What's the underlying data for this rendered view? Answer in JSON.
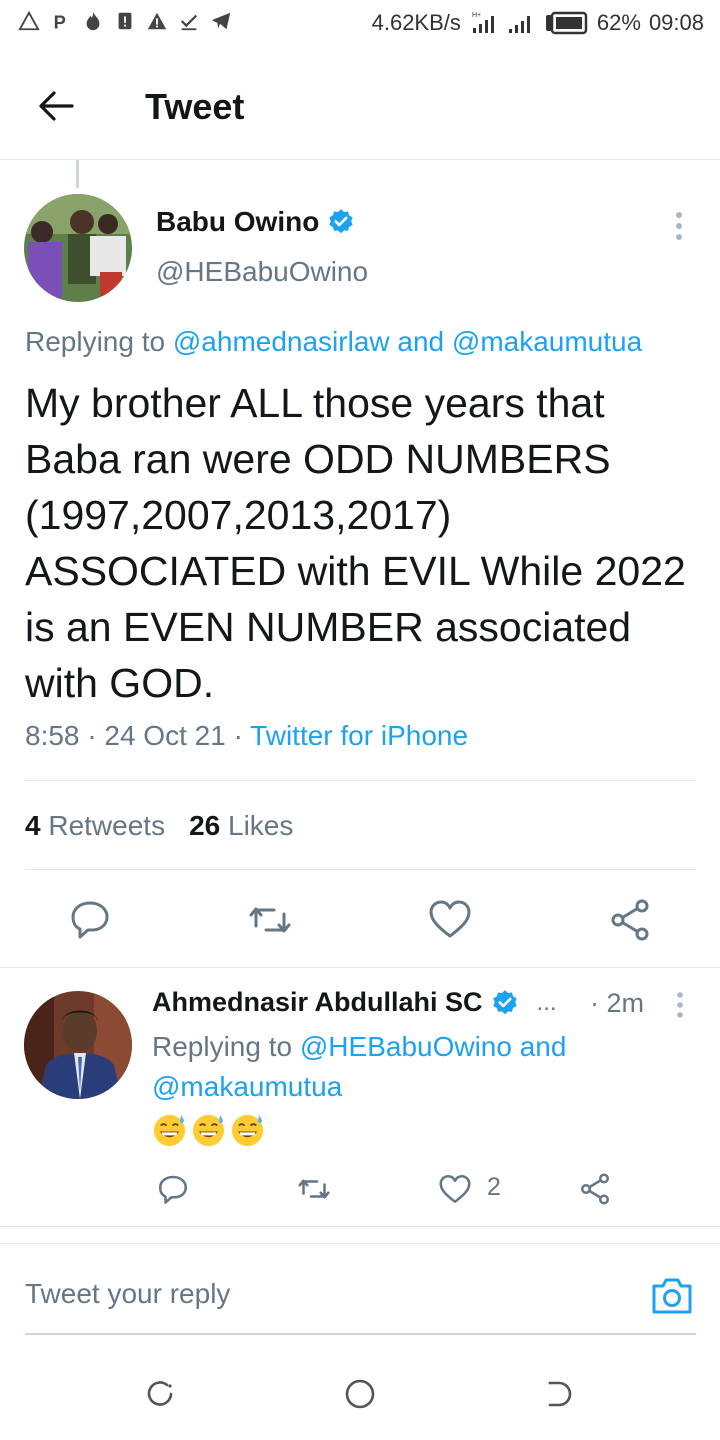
{
  "status_bar": {
    "speed": "4.62KB/s",
    "battery": "62%",
    "time": "09:08"
  },
  "header": {
    "title": "Tweet"
  },
  "tweet": {
    "name": "Babu Owino",
    "handle": "@HEBabuOwino",
    "replying_prefix": "Replying to",
    "replying_mentions": "@ahmednasirlaw and @makaumutua",
    "text": "My brother ALL those years that Baba ran were ODD NUMBERS (1997,2007,2013,2017) ASSOCIATED with EVIL While 2022 is an EVEN NUMBER associated with GOD.",
    "time_date": "8:58 · 24 Oct 21 · ",
    "source": "Twitter for iPhone",
    "retweets_count": "4",
    "retweets_label": "Retweets",
    "likes_count": "26",
    "likes_label": "Likes"
  },
  "reply": {
    "name": "Ahmednasir Abdullahi SC",
    "ellipsis": "...",
    "time": "· 2m",
    "replying_prefix": "Replying to",
    "replying_mentions": "@HEBabuOwino and @makaumutua",
    "like_count": "2"
  },
  "composer": {
    "placeholder": "Tweet your reply"
  },
  "colors": {
    "accent": "#1da1f2",
    "text": "#14171a",
    "secondary": "#657786",
    "border": "#e1e8ed"
  },
  "icons": {
    "back": "arrow-left-icon",
    "verified": "verified-badge-icon",
    "more": "more-vertical-icon",
    "reply": "reply-icon",
    "retweet": "retweet-icon",
    "like": "heart-icon",
    "share": "share-icon",
    "camera": "camera-icon",
    "emoji": "grinning-sweat-emoji"
  }
}
